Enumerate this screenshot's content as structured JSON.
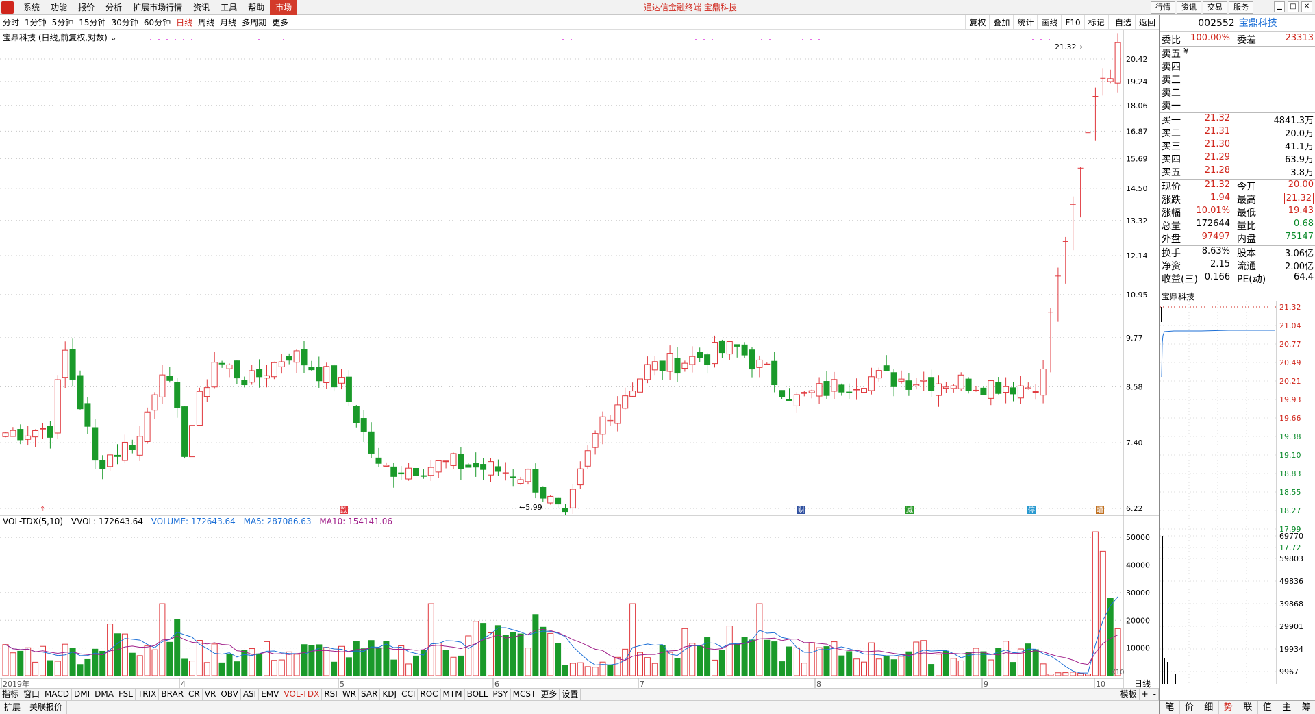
{
  "menu": {
    "items": [
      "系统",
      "功能",
      "报价",
      "分析",
      "扩展市场行情",
      "资讯",
      "工具",
      "帮助"
    ],
    "active": "市场",
    "title": "通达信金融终端  宝鼎科技",
    "buttons": [
      "行情",
      "资讯",
      "交易",
      "服务"
    ]
  },
  "periods": {
    "items": [
      "分时",
      "1分钟",
      "5分钟",
      "15分钟",
      "30分钟",
      "60分钟",
      "日线",
      "周线",
      "月线",
      "多周期",
      "更多"
    ],
    "selected": "日线"
  },
  "tools": [
    "复权",
    "叠加",
    "统计",
    "画线",
    "F10",
    "标记",
    "-自选",
    "返回"
  ],
  "stock": {
    "name": "宝鼎科技",
    "desc": "宝鼎科技 (日线,前复权,对数)",
    "code": "002552"
  },
  "vol": {
    "name": "VOL-TDX(5,10)",
    "vvol": "VVOL: 172643.64",
    "volume": "VOLUME: 172643.64",
    "ma5": "MA5: 287086.63",
    "ma10": "MA10: 154141.06",
    "x10": "X10"
  },
  "markers": {
    "low": "5.99",
    "high": "21.32"
  },
  "indicators": [
    "指标",
    "窗口",
    "MACD",
    "DMI",
    "DMA",
    "FSL",
    "TRIX",
    "BRAR",
    "CR",
    "VR",
    "OBV",
    "ASI",
    "EMV",
    "VOL-TDX",
    "RSI",
    "WR",
    "SAR",
    "KDJ",
    "CCI",
    "ROC",
    "MTM",
    "BOLL",
    "PSY",
    "MCST",
    "更多",
    "设置"
  ],
  "indicator_selected": "VOL-TDX",
  "indicator_right": [
    "模板",
    "+",
    "-"
  ],
  "bottom": [
    "扩展",
    "关联报价"
  ],
  "period_label": "日线",
  "quote": {
    "wb": {
      "label": "委比",
      "value": "100.00%",
      "diff_label": "委差",
      "diff": "23313"
    },
    "sell": [
      {
        "label": "卖五",
        "extra": "¥"
      },
      {
        "label": "卖四"
      },
      {
        "label": "卖三"
      },
      {
        "label": "卖二"
      },
      {
        "label": "卖一"
      }
    ],
    "buy": [
      {
        "label": "买一",
        "price": "21.32",
        "vol": "4841.3万"
      },
      {
        "label": "买二",
        "price": "21.31",
        "vol": "20.0万"
      },
      {
        "label": "买三",
        "price": "21.30",
        "vol": "41.1万"
      },
      {
        "label": "买四",
        "price": "21.29",
        "vol": "63.9万"
      },
      {
        "label": "买五",
        "price": "21.28",
        "vol": "3.8万"
      }
    ],
    "stats1": [
      {
        "l": "现价",
        "v": "21.32",
        "m": "今开",
        "r": "20.00",
        "rc": "red"
      },
      {
        "l": "涨跌",
        "v": "1.94",
        "m": "最高",
        "r": "21.32",
        "rc": "red"
      },
      {
        "l": "涨幅",
        "v": "10.01%",
        "m": "最低",
        "r": "19.43",
        "rc": "red"
      },
      {
        "l": "总量",
        "v": "172644",
        "m": "量比",
        "r": "0.68",
        "rc": "green",
        "vc": "blk"
      },
      {
        "l": "外盘",
        "v": "97497",
        "m": "内盘",
        "r": "75147",
        "rc": "green"
      }
    ],
    "stats2": [
      {
        "l": "换手",
        "v": "8.63%",
        "m": "股本",
        "r": "3.06亿"
      },
      {
        "l": "净资",
        "v": "2.15",
        "m": "流通",
        "r": "2.00亿"
      },
      {
        "l": "收益(三)",
        "v": "0.166",
        "m": "PE(动)",
        "r": "64.4"
      }
    ]
  },
  "mini": {
    "title": "宝鼎科技",
    "price_ticks": [
      "21.32",
      "21.04",
      "20.77",
      "20.49",
      "20.21",
      "19.93",
      "19.66",
      "19.38",
      "19.10",
      "18.83",
      "18.55",
      "18.27",
      "17.99",
      "17.72"
    ],
    "vol_ticks": [
      "69770",
      "59803",
      "49836",
      "39868",
      "29901",
      "19934",
      "9967"
    ]
  },
  "mini_tabs": [
    "笔",
    "价",
    "细",
    "势",
    "联",
    "值",
    "主",
    "筹"
  ],
  "mini_tab_selected": "势",
  "chart_data": {
    "type": "candlestick",
    "price_ticks": [
      "20.42",
      "19.24",
      "18.06",
      "16.87",
      "15.69",
      "14.50",
      "13.32",
      "12.14",
      "10.95",
      "9.77",
      "8.58",
      "7.40",
      "6.22"
    ],
    "vol_ticks": [
      "50000",
      "40000",
      "30000",
      "20000",
      "10000"
    ],
    "x_labels": [
      "2019年",
      "4",
      "5",
      "6",
      "7",
      "8",
      "9",
      "10"
    ],
    "events": [
      "跌",
      "财",
      "减",
      "停",
      "增"
    ]
  }
}
